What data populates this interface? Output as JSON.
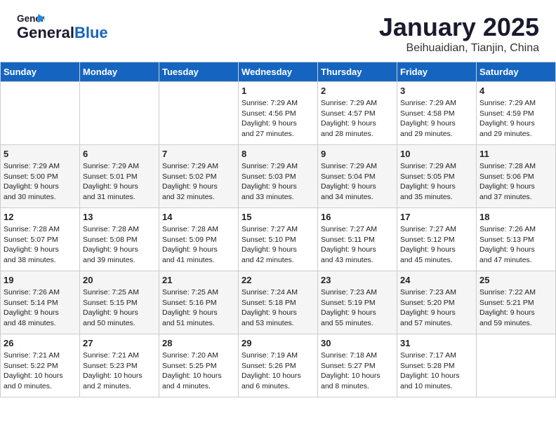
{
  "header": {
    "logo_line1": "General",
    "logo_line2": "Blue",
    "month": "January 2025",
    "location": "Beihuaidian, Tianjin, China"
  },
  "weekdays": [
    "Sunday",
    "Monday",
    "Tuesday",
    "Wednesday",
    "Thursday",
    "Friday",
    "Saturday"
  ],
  "weeks": [
    [
      {
        "day": "",
        "info": ""
      },
      {
        "day": "",
        "info": ""
      },
      {
        "day": "",
        "info": ""
      },
      {
        "day": "1",
        "info": "Sunrise: 7:29 AM\nSunset: 4:56 PM\nDaylight: 9 hours\nand 27 minutes."
      },
      {
        "day": "2",
        "info": "Sunrise: 7:29 AM\nSunset: 4:57 PM\nDaylight: 9 hours\nand 28 minutes."
      },
      {
        "day": "3",
        "info": "Sunrise: 7:29 AM\nSunset: 4:58 PM\nDaylight: 9 hours\nand 29 minutes."
      },
      {
        "day": "4",
        "info": "Sunrise: 7:29 AM\nSunset: 4:59 PM\nDaylight: 9 hours\nand 29 minutes."
      }
    ],
    [
      {
        "day": "5",
        "info": "Sunrise: 7:29 AM\nSunset: 5:00 PM\nDaylight: 9 hours\nand 30 minutes."
      },
      {
        "day": "6",
        "info": "Sunrise: 7:29 AM\nSunset: 5:01 PM\nDaylight: 9 hours\nand 31 minutes."
      },
      {
        "day": "7",
        "info": "Sunrise: 7:29 AM\nSunset: 5:02 PM\nDaylight: 9 hours\nand 32 minutes."
      },
      {
        "day": "8",
        "info": "Sunrise: 7:29 AM\nSunset: 5:03 PM\nDaylight: 9 hours\nand 33 minutes."
      },
      {
        "day": "9",
        "info": "Sunrise: 7:29 AM\nSunset: 5:04 PM\nDaylight: 9 hours\nand 34 minutes."
      },
      {
        "day": "10",
        "info": "Sunrise: 7:29 AM\nSunset: 5:05 PM\nDaylight: 9 hours\nand 35 minutes."
      },
      {
        "day": "11",
        "info": "Sunrise: 7:28 AM\nSunset: 5:06 PM\nDaylight: 9 hours\nand 37 minutes."
      }
    ],
    [
      {
        "day": "12",
        "info": "Sunrise: 7:28 AM\nSunset: 5:07 PM\nDaylight: 9 hours\nand 38 minutes."
      },
      {
        "day": "13",
        "info": "Sunrise: 7:28 AM\nSunset: 5:08 PM\nDaylight: 9 hours\nand 39 minutes."
      },
      {
        "day": "14",
        "info": "Sunrise: 7:28 AM\nSunset: 5:09 PM\nDaylight: 9 hours\nand 41 minutes."
      },
      {
        "day": "15",
        "info": "Sunrise: 7:27 AM\nSunset: 5:10 PM\nDaylight: 9 hours\nand 42 minutes."
      },
      {
        "day": "16",
        "info": "Sunrise: 7:27 AM\nSunset: 5:11 PM\nDaylight: 9 hours\nand 43 minutes."
      },
      {
        "day": "17",
        "info": "Sunrise: 7:27 AM\nSunset: 5:12 PM\nDaylight: 9 hours\nand 45 minutes."
      },
      {
        "day": "18",
        "info": "Sunrise: 7:26 AM\nSunset: 5:13 PM\nDaylight: 9 hours\nand 47 minutes."
      }
    ],
    [
      {
        "day": "19",
        "info": "Sunrise: 7:26 AM\nSunset: 5:14 PM\nDaylight: 9 hours\nand 48 minutes."
      },
      {
        "day": "20",
        "info": "Sunrise: 7:25 AM\nSunset: 5:15 PM\nDaylight: 9 hours\nand 50 minutes."
      },
      {
        "day": "21",
        "info": "Sunrise: 7:25 AM\nSunset: 5:16 PM\nDaylight: 9 hours\nand 51 minutes."
      },
      {
        "day": "22",
        "info": "Sunrise: 7:24 AM\nSunset: 5:18 PM\nDaylight: 9 hours\nand 53 minutes."
      },
      {
        "day": "23",
        "info": "Sunrise: 7:23 AM\nSunset: 5:19 PM\nDaylight: 9 hours\nand 55 minutes."
      },
      {
        "day": "24",
        "info": "Sunrise: 7:23 AM\nSunset: 5:20 PM\nDaylight: 9 hours\nand 57 minutes."
      },
      {
        "day": "25",
        "info": "Sunrise: 7:22 AM\nSunset: 5:21 PM\nDaylight: 9 hours\nand 59 minutes."
      }
    ],
    [
      {
        "day": "26",
        "info": "Sunrise: 7:21 AM\nSunset: 5:22 PM\nDaylight: 10 hours\nand 0 minutes."
      },
      {
        "day": "27",
        "info": "Sunrise: 7:21 AM\nSunset: 5:23 PM\nDaylight: 10 hours\nand 2 minutes."
      },
      {
        "day": "28",
        "info": "Sunrise: 7:20 AM\nSunset: 5:25 PM\nDaylight: 10 hours\nand 4 minutes."
      },
      {
        "day": "29",
        "info": "Sunrise: 7:19 AM\nSunset: 5:26 PM\nDaylight: 10 hours\nand 6 minutes."
      },
      {
        "day": "30",
        "info": "Sunrise: 7:18 AM\nSunset: 5:27 PM\nDaylight: 10 hours\nand 8 minutes."
      },
      {
        "day": "31",
        "info": "Sunrise: 7:17 AM\nSunset: 5:28 PM\nDaylight: 10 hours\nand 10 minutes."
      },
      {
        "day": "",
        "info": ""
      }
    ]
  ]
}
